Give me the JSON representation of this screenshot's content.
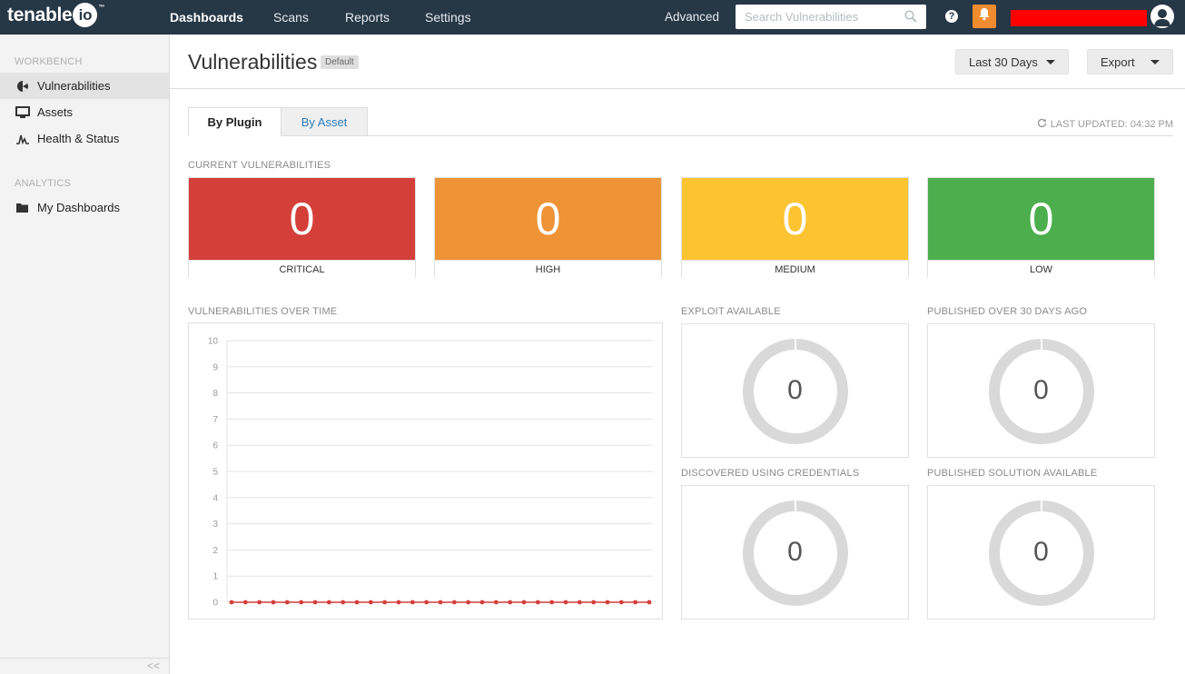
{
  "app": {
    "logo_text": "tenable",
    "logo_io": "io",
    "logo_tm": "™"
  },
  "nav": {
    "items": [
      {
        "label": "Dashboards",
        "active": true
      },
      {
        "label": "Scans"
      },
      {
        "label": "Reports"
      },
      {
        "label": "Settings"
      }
    ],
    "advanced_label": "Advanced",
    "search_placeholder": "Search Vulnerabilities",
    "help_icon": "question-icon",
    "bell_icon": "bell-icon",
    "accent_bell": "#f08c2e",
    "redacted_color": "#fe0000"
  },
  "sidebar": {
    "workbench_label": "WORKBENCH",
    "workbench_items": [
      {
        "label": "Vulnerabilities",
        "icon": "vulnerabilities-icon",
        "active": true
      },
      {
        "label": "Assets",
        "icon": "monitor-icon"
      },
      {
        "label": "Health & Status",
        "icon": "pulse-icon"
      }
    ],
    "analytics_label": "ANALYTICS",
    "analytics_items": [
      {
        "label": "My Dashboards",
        "icon": "folder-icon"
      }
    ],
    "collapse_label": "<<"
  },
  "header": {
    "title": "Vulnerabilities",
    "badge": "Default",
    "range_label": "Last 30 Days",
    "export_label": "Export"
  },
  "tabs": [
    {
      "label": "By Plugin",
      "active": true
    },
    {
      "label": "By Asset"
    }
  ],
  "last_updated": "LAST UPDATED: 04:32 PM",
  "current": {
    "label": "CURRENT VULNERABILITIES",
    "cards": [
      {
        "value": "0",
        "label": "CRITICAL",
        "color": "#d43f3a"
      },
      {
        "value": "0",
        "label": "HIGH",
        "color": "#ee9336"
      },
      {
        "value": "0",
        "label": "MEDIUM",
        "color": "#fdc431"
      },
      {
        "value": "0",
        "label": "LOW",
        "color": "#4cae4c"
      }
    ]
  },
  "over_time": {
    "label": "VULNERABILITIES OVER TIME"
  },
  "donuts": [
    {
      "label": "EXPLOIT AVAILABLE",
      "value": "0"
    },
    {
      "label": "PUBLISHED OVER 30 DAYS AGO",
      "value": "0"
    },
    {
      "label": "DISCOVERED USING CREDENTIALS",
      "value": "0"
    },
    {
      "label": "PUBLISHED SOLUTION AVAILABLE",
      "value": "0"
    }
  ],
  "chart_data": {
    "type": "line",
    "title": "VULNERABILITIES OVER TIME",
    "ylim": [
      0,
      10
    ],
    "y_ticks": [
      "0",
      "1",
      "2",
      "3",
      "4",
      "5",
      "6",
      "7",
      "8",
      "9",
      "10"
    ],
    "grid": true,
    "series": [
      {
        "color": "#d43f3a",
        "values": [
          0,
          0,
          0,
          0,
          0,
          0,
          0,
          0,
          0,
          0,
          0,
          0,
          0,
          0,
          0,
          0,
          0,
          0,
          0,
          0,
          0,
          0,
          0,
          0,
          0,
          0,
          0,
          0,
          0,
          0,
          0
        ]
      }
    ]
  }
}
